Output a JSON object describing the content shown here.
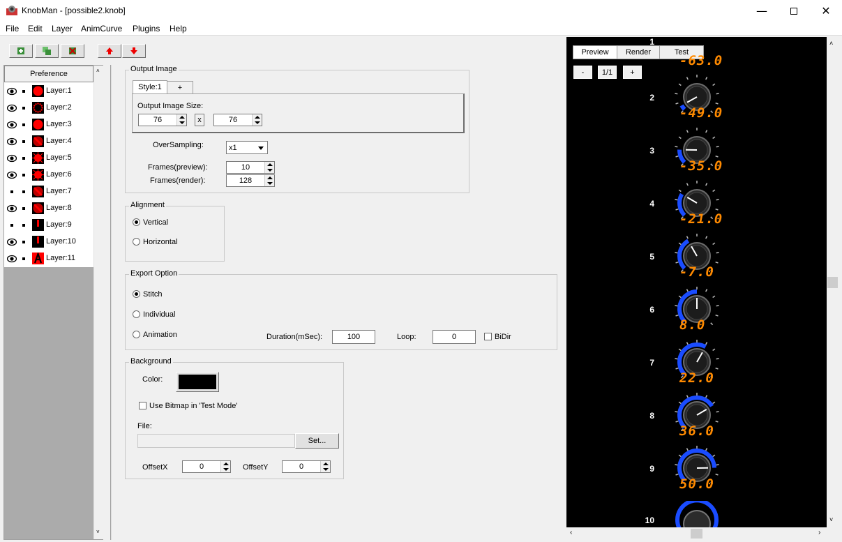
{
  "window": {
    "app": "KnobMan",
    "title": "KnobMan - [possible2.knob]"
  },
  "menu": [
    "File",
    "Edit",
    "Layer",
    "AnimCurve",
    "Plugins",
    "Help"
  ],
  "colors": {
    "knob_value": "#ff8a00",
    "knob_arc": "#1a4cff",
    "preview_bg": "#000000",
    "layer_thumb_red": "#ff0000"
  },
  "toolbar": [
    "add-layer-icon",
    "duplicate-layer-icon",
    "delete-layer-icon",
    "move-up-icon",
    "move-down-icon"
  ],
  "layers": {
    "preference_tab": "Preference",
    "items": [
      {
        "name": "Layer:1",
        "visible": true,
        "thumb": "red-circle"
      },
      {
        "name": "Layer:2",
        "visible": true,
        "thumb": "red-dots-ring"
      },
      {
        "name": "Layer:3",
        "visible": true,
        "thumb": "red-circle"
      },
      {
        "name": "Layer:4",
        "visible": true,
        "thumb": "red-diagonal"
      },
      {
        "name": "Layer:5",
        "visible": true,
        "thumb": "red-burst"
      },
      {
        "name": "Layer:6",
        "visible": true,
        "thumb": "red-burst"
      },
      {
        "name": "Layer:7",
        "visible": false,
        "thumb": "red-diagonal"
      },
      {
        "name": "Layer:8",
        "visible": true,
        "thumb": "red-diagonal"
      },
      {
        "name": "Layer:9",
        "visible": false,
        "thumb": "red-bar"
      },
      {
        "name": "Layer:10",
        "visible": true,
        "thumb": "red-bar"
      },
      {
        "name": "Layer:11",
        "visible": true,
        "thumb": "red-letter-a"
      }
    ]
  },
  "output_image": {
    "group_label": "Output Image",
    "style_tab": "Style:1",
    "add_tab": "+",
    "size_label": "Output Image Size:",
    "width": "76",
    "times": "x",
    "height": "76",
    "oversampling_label": "OverSampling:",
    "oversampling_value": "x1",
    "frames_preview_label": "Frames(preview):",
    "frames_preview": "10",
    "frames_render_label": "Frames(render):",
    "frames_render": "128"
  },
  "alignment": {
    "group_label": "Alignment",
    "vertical": "Vertical",
    "horizontal": "Horizontal",
    "selected": "Vertical"
  },
  "export": {
    "group_label": "Export Option",
    "stitch": "Stitch",
    "individual": "Individual",
    "animation": "Animation",
    "selected": "Stitch",
    "duration_label": "Duration(mSec):",
    "duration": "100",
    "loop_label": "Loop:",
    "loop": "0",
    "bidir_label": "BiDir"
  },
  "background": {
    "group_label": "Background",
    "color_label": "Color:",
    "color_value": "#000000",
    "use_bitmap_label": "Use Bitmap in 'Test Mode'",
    "file_label": "File:",
    "file_value": "",
    "set_button": "Set...",
    "offsetx_label": "OffsetX",
    "offsetx": "0",
    "offsety_label": "OffsetY",
    "offsety": "0"
  },
  "preview": {
    "tabs": [
      "Preview",
      "Render",
      "Test"
    ],
    "active_tab": "Preview",
    "zoom_out": "-",
    "zoom_level": "1/1",
    "zoom_in": "+",
    "first_value": "-63.0",
    "frames": [
      {
        "num": "2",
        "value": "-49.0",
        "level": 0.06
      },
      {
        "num": "3",
        "value": "-35.0",
        "level": 0.17
      },
      {
        "num": "4",
        "value": "-21.0",
        "level": 0.28
      },
      {
        "num": "5",
        "value": "-7.0",
        "level": 0.39
      },
      {
        "num": "6",
        "value": "8.0",
        "level": 0.5
      },
      {
        "num": "7",
        "value": "22.0",
        "level": 0.61
      },
      {
        "num": "8",
        "value": "36.0",
        "level": 0.72
      },
      {
        "num": "9",
        "value": "50.0",
        "level": 0.83
      }
    ],
    "first_num": "1",
    "last_num": "10"
  }
}
